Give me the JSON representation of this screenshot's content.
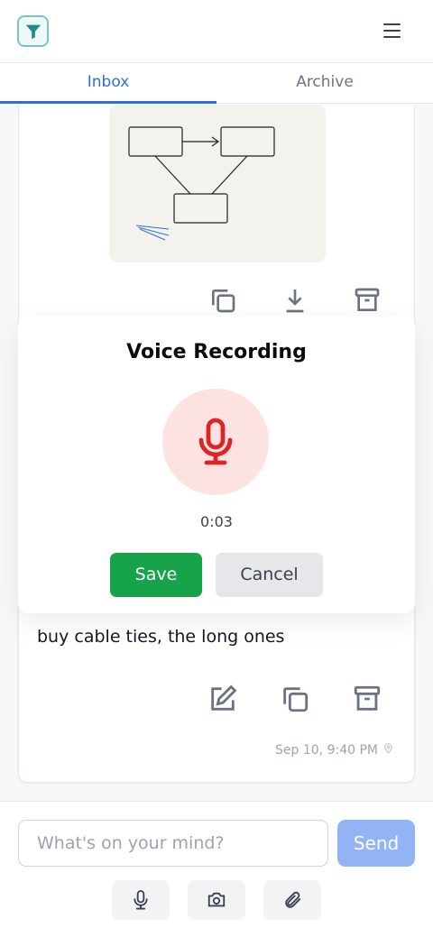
{
  "header": {
    "logo_icon": "funnel-logo-icon",
    "menu_icon": "hamburger-menu-icon"
  },
  "tabs": [
    {
      "label": "Inbox",
      "active": true
    },
    {
      "label": "Archive",
      "active": false
    }
  ],
  "top_card": {
    "image_icon": "flow-diagram-image",
    "actions": [
      "copy-icon",
      "download-icon",
      "archive-icon"
    ]
  },
  "recording_modal": {
    "title": "Voice Recording",
    "mic_icon": "microphone-icon",
    "timer": "0:03",
    "save_label": "Save",
    "cancel_label": "Cancel",
    "colors": {
      "save": "#16a34a",
      "mic": "#dc2626",
      "mic_bg": "#fde2e2"
    }
  },
  "note_card": {
    "text": "buy cable ties, the long ones",
    "actions": [
      "edit-icon",
      "copy-icon",
      "archive-icon"
    ],
    "timestamp": "Sep 10, 9:40 PM",
    "location_icon": "location-pin-icon"
  },
  "composer": {
    "placeholder": "What's on your mind?",
    "send_label": "Send",
    "tools": [
      "microphone-icon",
      "camera-icon",
      "paperclip-icon"
    ]
  },
  "accent_color": "#2f6fd6"
}
